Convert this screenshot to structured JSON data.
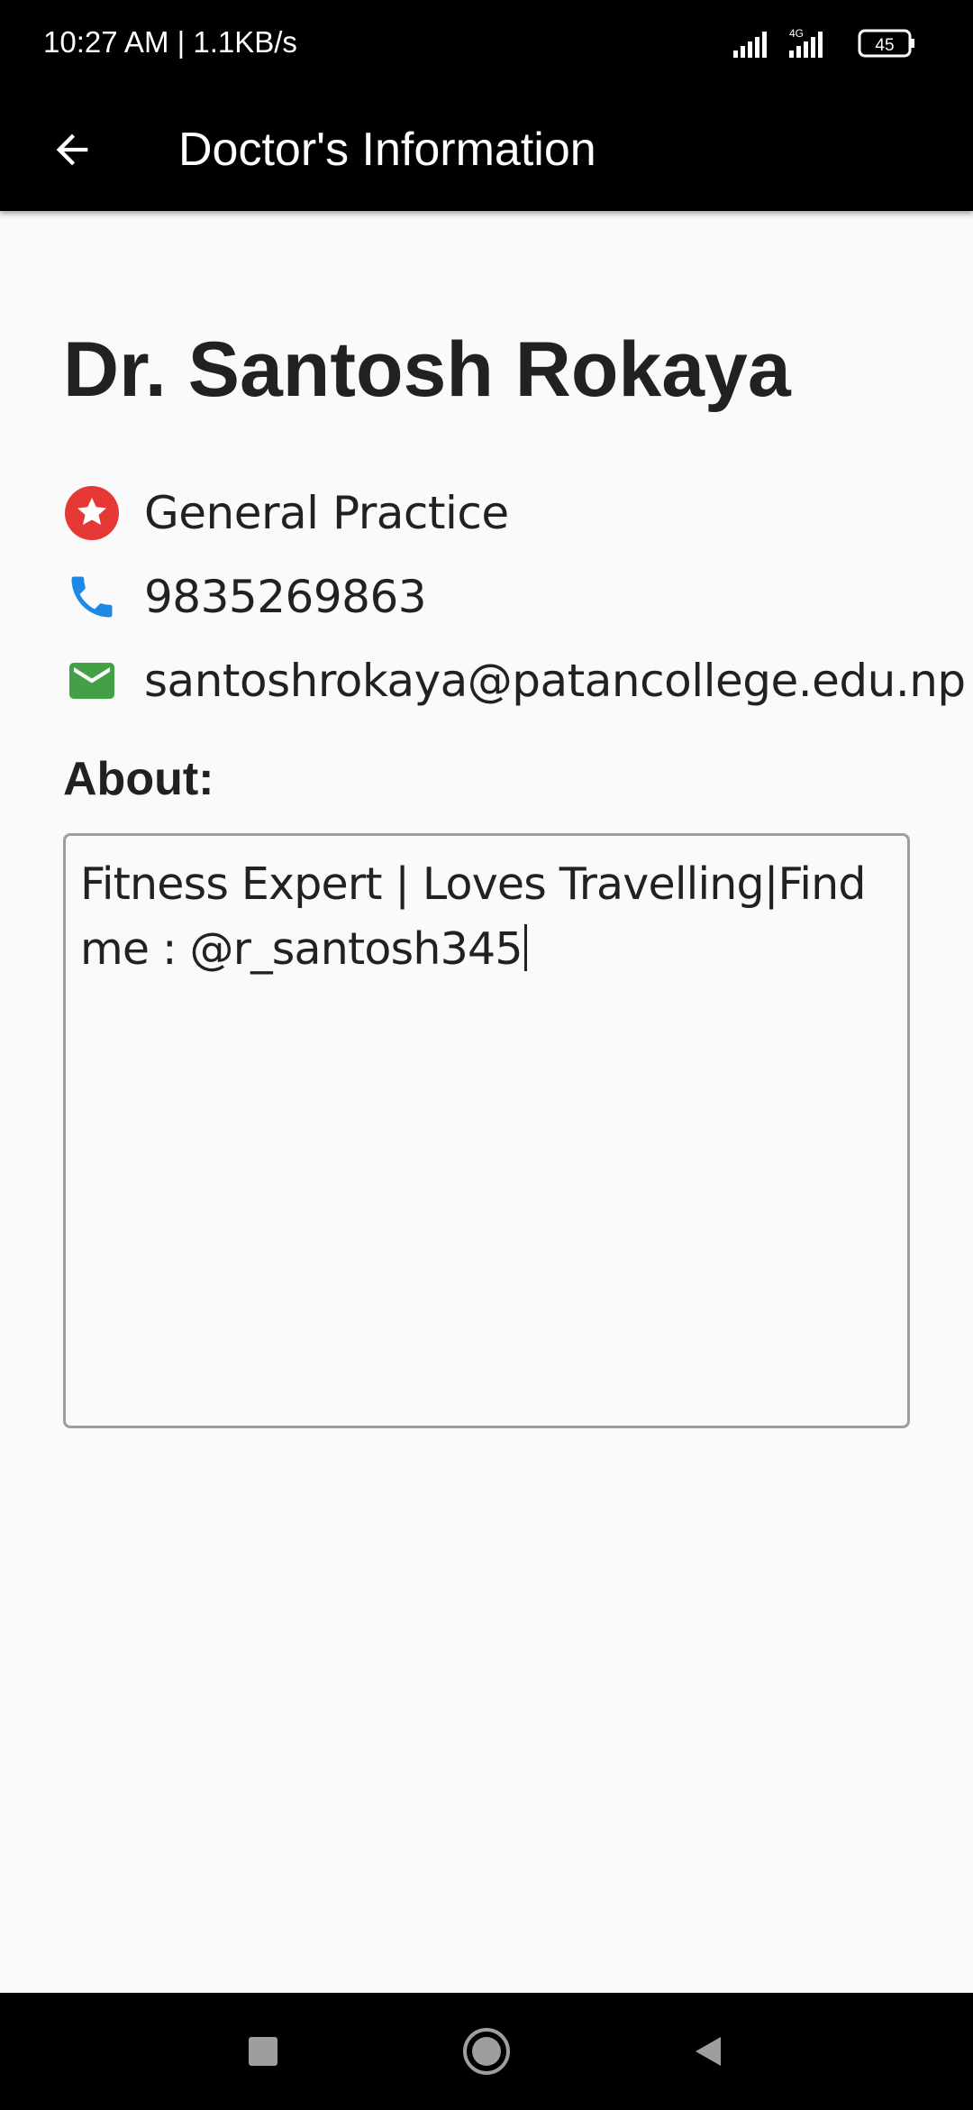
{
  "status_bar": {
    "time_speed": "10:27 AM | 1.1KB/s",
    "network_label": "4G",
    "battery": "45"
  },
  "app_bar": {
    "title": "Doctor's Information",
    "back_icon": "arrow-left-icon"
  },
  "doctor": {
    "name": "Dr. Santosh Rokaya",
    "specialty": "General Practice",
    "phone": "9835269863",
    "email": "santoshrokaya@patancollege.edu.np"
  },
  "about": {
    "label": "About:",
    "text": "Fitness Expert | Loves Travelling|Find me : @r_santosh345"
  },
  "colors": {
    "specialty_icon": "#e53935",
    "phone_icon": "#1e88e5",
    "email_icon": "#43a047",
    "app_bar": "#000000",
    "background": "#fafafa"
  },
  "nav_bar": {
    "icons": [
      "recents-square-icon",
      "home-circle-icon",
      "back-triangle-icon"
    ]
  }
}
